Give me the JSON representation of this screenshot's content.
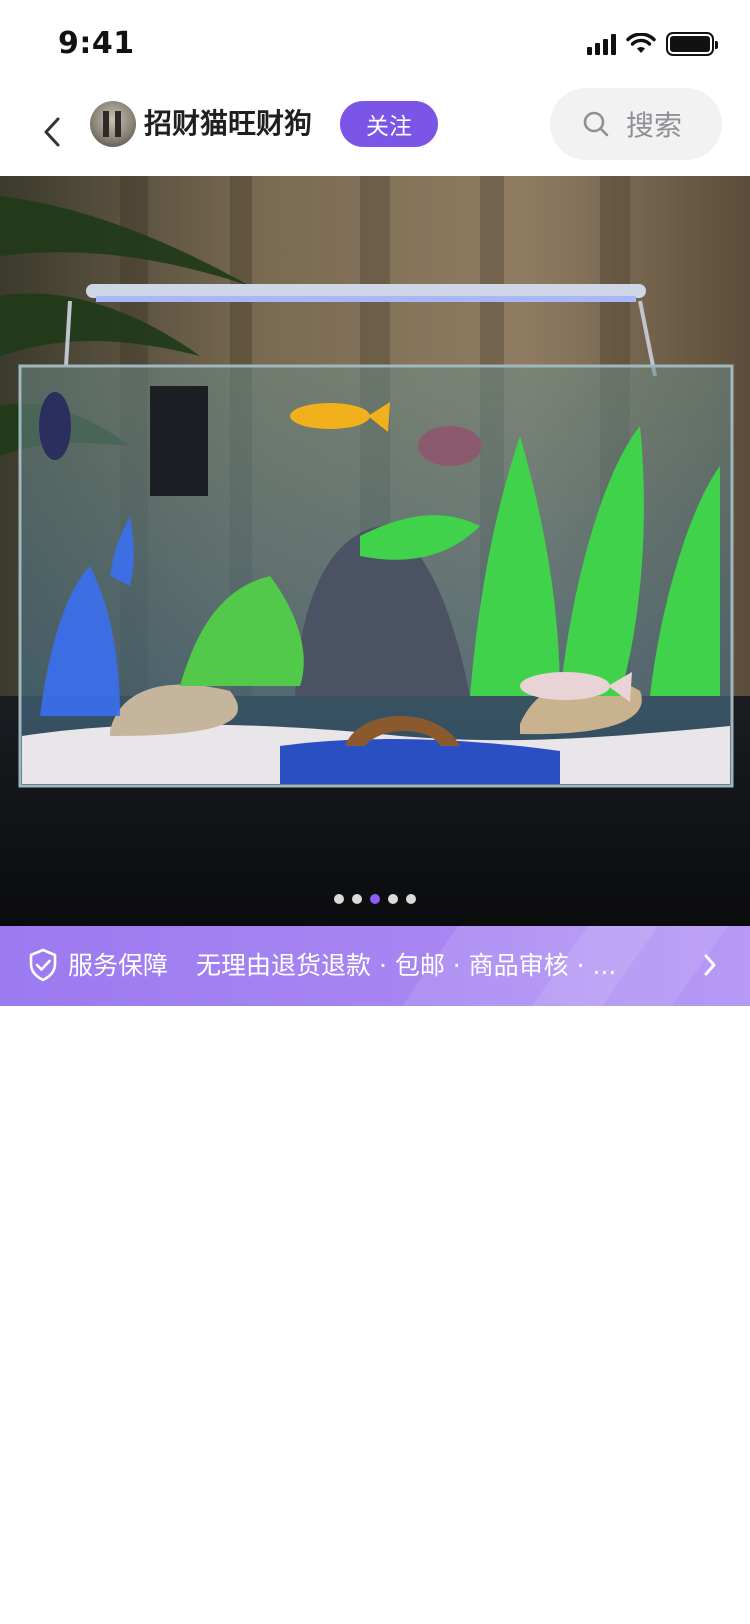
{
  "status_bar": {
    "time": "9:41"
  },
  "header": {
    "shop_name": "招财猫旺财狗",
    "follow_label": "关注",
    "search_label": "搜索"
  },
  "hero": {
    "image_count": 5,
    "active_index": 2
  },
  "service": {
    "title": "服务保障",
    "description": "无理由退货退款 · 包邮 · 商品审核 · ..."
  },
  "colors": {
    "accent": "#7b55e6",
    "banner": "#a887f2",
    "search_bg": "#f2f2f3"
  },
  "icons": {
    "back": "chevron-left-icon",
    "search": "search-icon",
    "shield": "shield-check-icon",
    "arrow": "chevron-right-icon"
  }
}
